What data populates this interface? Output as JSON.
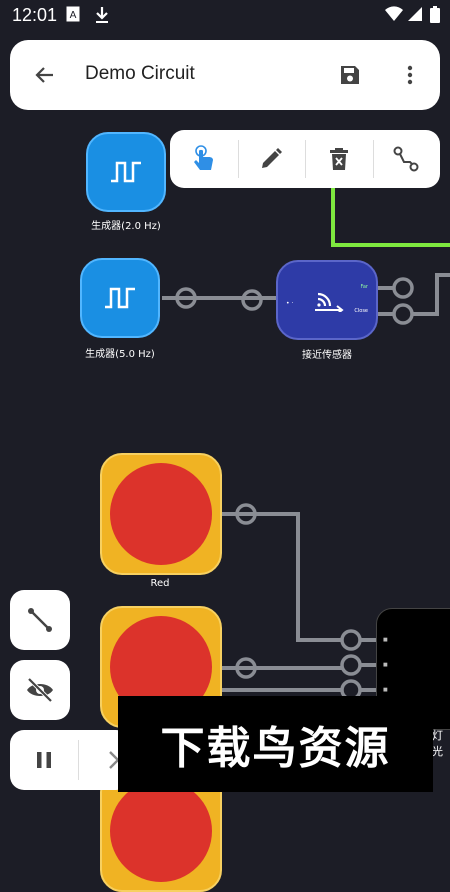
{
  "status_bar": {
    "time": "12:01",
    "icons": [
      "text-a-icon",
      "download-icon",
      "wifi-icon",
      "signal-icon",
      "battery-icon"
    ]
  },
  "app_bar": {
    "title": "Demo Circuit",
    "icons": [
      "back-arrow-icon",
      "save-icon",
      "more-vert-icon"
    ]
  },
  "toolbar": {
    "tools": [
      "touch-icon",
      "edit-pencil-icon",
      "delete-icon",
      "connect-wire-icon"
    ],
    "accent": "#2f8fe6"
  },
  "nodes": {
    "gen1_label": "生成器(2.0 Hz)",
    "gen2_label": "生成器(5.0 Hz)",
    "sensor_label": "接近传感器",
    "sensor_far": "Far",
    "sensor_close": "Close",
    "lamp1_label": "Red",
    "display_label": "灯光"
  },
  "side_controls": {
    "icons": [
      "wire-icon",
      "visibility-off-icon",
      "pause-icon",
      "chevron-right-icon"
    ]
  },
  "watermark": {
    "text": "下载鸟资源"
  },
  "colors": {
    "background": "#1c1d26",
    "generator": "#1a8fe3",
    "sensor": "#2e3ba7",
    "lamp_frame": "#f0b323",
    "lamp_bulb": "#dc332b",
    "wire": "#8a8d94",
    "wire_active": "#7ee83f"
  }
}
